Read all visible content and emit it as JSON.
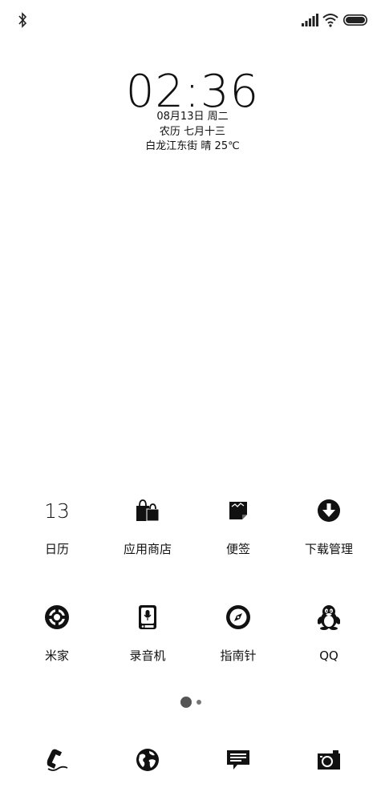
{
  "status_bar": {
    "icons": [
      "bluetooth-icon",
      "signal-icon",
      "wifi-icon",
      "battery-icon"
    ]
  },
  "clock": {
    "time": "02:36",
    "date": "08月13日 周二",
    "lunar": "农历 七月十三",
    "weather": "白龙江东街 晴 25℃"
  },
  "apps": [
    {
      "label": "日历",
      "icon": "calendar-icon",
      "badge": "13"
    },
    {
      "label": "应用商店",
      "icon": "shopping-bags-icon"
    },
    {
      "label": "便签",
      "icon": "note-icon"
    },
    {
      "label": "下载管理",
      "icon": "download-icon"
    },
    {
      "label": "米家",
      "icon": "mijia-icon"
    },
    {
      "label": "录音机",
      "icon": "recorder-icon"
    },
    {
      "label": "指南针",
      "icon": "compass-icon"
    },
    {
      "label": "QQ",
      "icon": "qq-penguin-icon"
    }
  ],
  "pager": {
    "pages": 2,
    "current": 1
  },
  "dock": [
    "phone-icon",
    "browser-globe-icon",
    "messages-icon",
    "camera-icon"
  ]
}
